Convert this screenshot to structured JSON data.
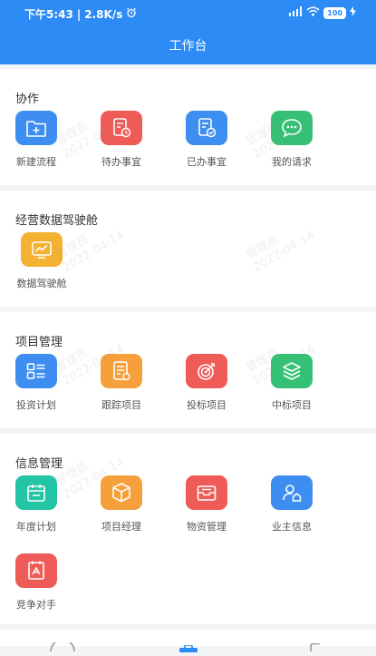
{
  "status_bar": {
    "time": "下午5:43",
    "separator": "|",
    "speed": "2.8K/s",
    "battery": "100"
  },
  "header": {
    "title": "工作台"
  },
  "watermark": {
    "name": "管理员",
    "date": "2022-04-14"
  },
  "sections": [
    {
      "title": "协作",
      "items": [
        {
          "label": "新建流程",
          "icon": "new-folder-icon",
          "color": "#3d8ef0"
        },
        {
          "label": "待办事宜",
          "icon": "pending-doc-icon",
          "color": "#ef5b57"
        },
        {
          "label": "已办事宜",
          "icon": "done-doc-icon",
          "color": "#3d8ef0"
        },
        {
          "label": "我的请求",
          "icon": "chat-bubble-icon",
          "color": "#34c176"
        }
      ]
    },
    {
      "title": "经营数据驾驶舱",
      "items": [
        {
          "label": "数据驾驶舱",
          "icon": "monitor-chart-icon",
          "color": "#f5b131"
        }
      ]
    },
    {
      "title": "项目管理",
      "items": [
        {
          "label": "投资计划",
          "icon": "grid-list-icon",
          "color": "#3d8ef0"
        },
        {
          "label": "跟踪项目",
          "icon": "track-doc-icon",
          "color": "#f5a03b"
        },
        {
          "label": "投标项目",
          "icon": "target-icon",
          "color": "#ef5b57"
        },
        {
          "label": "中标项目",
          "icon": "layers-icon",
          "color": "#34c176"
        }
      ]
    },
    {
      "title": "信息管理",
      "items": [
        {
          "label": "年度计划",
          "icon": "calendar-icon",
          "color": "#23c5a5"
        },
        {
          "label": "项目经理",
          "icon": "cube-icon",
          "color": "#f5a03b"
        },
        {
          "label": "物资管理",
          "icon": "tray-icon",
          "color": "#ef5b57"
        },
        {
          "label": "业主信息",
          "icon": "user-home-icon",
          "color": "#3d8ef0"
        },
        {
          "label": "竞争对手",
          "icon": "competitor-icon",
          "color": "#ef5b57"
        }
      ]
    }
  ]
}
